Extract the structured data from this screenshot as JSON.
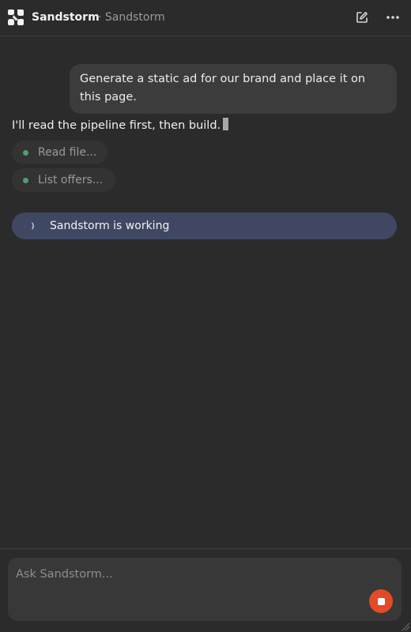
{
  "header": {
    "app_name": "Sandstorm",
    "context": "· Sandstorm",
    "icons": {
      "logo": "sandstorm-logo-icon",
      "compose": "compose-icon",
      "more": "more-horizontal-icon"
    }
  },
  "conversation": {
    "user_message": "Generate a static ad for our brand and place it on this page.",
    "assistant_message": "I'll read the pipeline first, then build.",
    "tool_calls": [
      {
        "label": "Read file..."
      },
      {
        "label": "List offers..."
      }
    ],
    "status": "Sandstorm is working"
  },
  "composer": {
    "placeholder": "Ask Sandstorm...",
    "value": ""
  },
  "colors": {
    "background": "#2b2b2b",
    "user_bubble": "#3c3c3c",
    "status_bar": "#3f4762",
    "tool_dot": "#4fa070",
    "stop_button": "#e34a27"
  }
}
